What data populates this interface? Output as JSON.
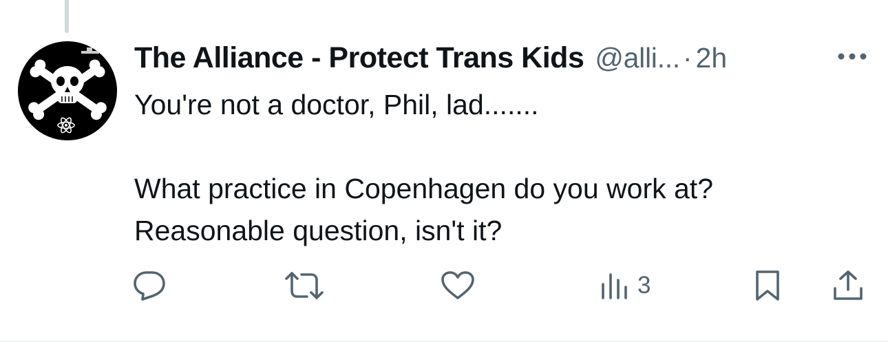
{
  "tweet": {
    "display_name": "The Alliance - Protect Trans Kids",
    "handle": "@alli...",
    "separator": "·",
    "time": "2h",
    "lines": [
      "You're not a doctor, Phil, lad.......",
      "What practice in Copenhagen do you work at?",
      "Reasonable question, isn't it?"
    ]
  },
  "actions": {
    "reply_icon": "reply-icon",
    "retweet_icon": "retweet-icon",
    "like_icon": "heart-icon",
    "views_icon": "bar-chart-icon",
    "views_count": "3",
    "bookmark_icon": "bookmark-icon",
    "share_icon": "share-icon",
    "more_icon": "more-icon"
  },
  "colors": {
    "text": "#0f1419",
    "secondary": "#536471",
    "thread_line": "#cfd9de"
  }
}
